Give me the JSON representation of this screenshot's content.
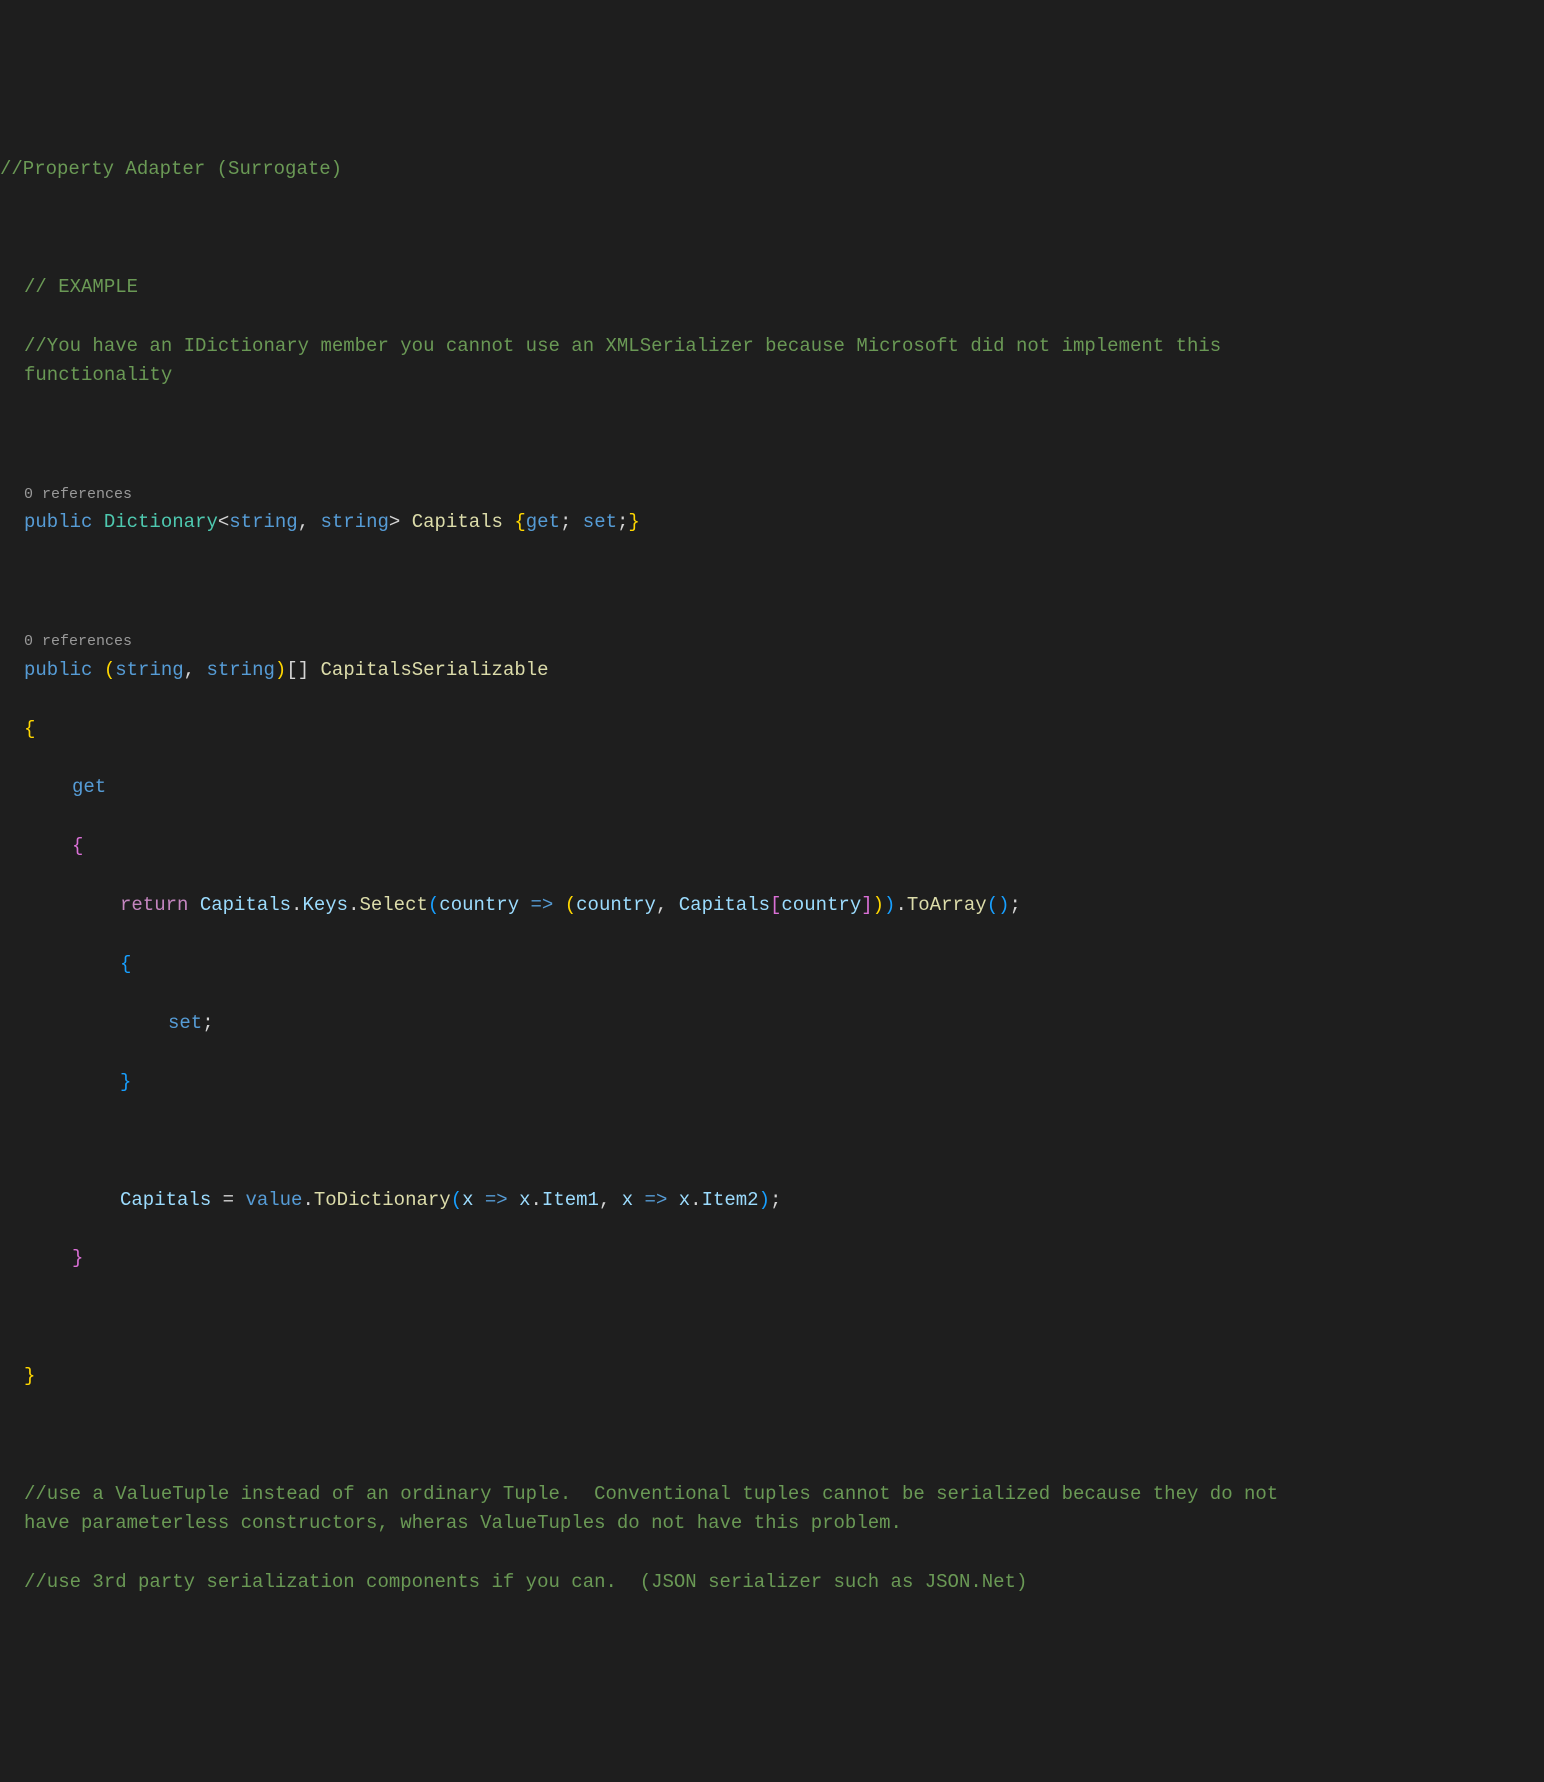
{
  "code": {
    "line1": "//Property Adapter (Surrogate)",
    "line2": "// EXAMPLE",
    "line3": "//You have an IDictionary member you cannot use an XMLSerializer because Microsoft did not implement this functionality",
    "codelens1": "0 references",
    "public1": "public",
    "dictionary": "Dictionary",
    "lt1": "<",
    "stringKw1": "string",
    "comma1": ", ",
    "stringKw2": "string",
    "gt1": "> ",
    "capitals1": "Capitals",
    "space1": " ",
    "lbrace1": "{",
    "get1": "get",
    "semi1": "; ",
    "set1": "set",
    "semi2": ";",
    "rbrace1": "}",
    "codelens2": "0 references",
    "public2": "public",
    "lparen1": " (",
    "stringKw3": "string",
    "comma2": ", ",
    "stringKw4": "string",
    "rparen1": ")",
    "brackets1": "[] ",
    "capitalsSerializable": "CapitalsSerializable",
    "lbrace2": "{",
    "get2": "get",
    "lbrace3": "{",
    "return1": "return",
    "capitals2": " Capitals",
    "dot1": ".",
    "keys": "Keys",
    "dot2": ".",
    "select": "Select",
    "lparen2": "(",
    "country1": "country",
    "arrow1": " => ",
    "lparen3": "(",
    "country2": "country",
    "comma3": ", ",
    "capitals3": "Capitals",
    "lbracket1": "[",
    "country3": "country",
    "rbracket1": "]",
    "rparen3": ")",
    "rparen2": ")",
    "dot3": ".",
    "toArray": "ToArray",
    "lparen4": "(",
    "rparen4": ")",
    "semi3": ";",
    "lbrace4": "{",
    "set2": "set",
    "semi4": ";",
    "rbrace4": "}",
    "capitals4": "Capitals",
    "eq1": " = ",
    "value1": "value",
    "dot4": ".",
    "toDictionary": "ToDictionary",
    "lparen5": "(",
    "x1": "x",
    "arrow2": " => ",
    "x2": "x",
    "dot5": ".",
    "item1": "Item1",
    "comma4": ", ",
    "x3": "x",
    "arrow3": " => ",
    "x4": "x",
    "dot6": ".",
    "item2": "Item2",
    "rparen5": ")",
    "semi5": ";",
    "rbrace3": "}",
    "rbrace2": "}",
    "footerComment1": "//use a ValueTuple instead of an ordinary Tuple.  Conventional tuples cannot be serialized because they do not have parameterless constructors, wheras ValueTuples do not have this problem.",
    "footerComment2": "//use 3rd party serialization components if you can.  (JSON serializer such as JSON.Net)"
  }
}
